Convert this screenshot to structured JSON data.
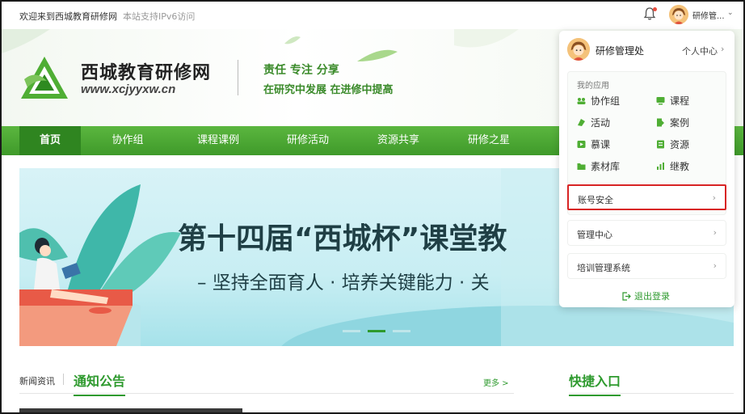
{
  "topbar": {
    "welcome": "欢迎来到西城教育研修网",
    "ipv6": "本站支持IPv6访问",
    "user_short": "研修管..."
  },
  "header": {
    "site_name": "西城教育研修网",
    "site_url": "www.xcjyyxw.cn",
    "slogan_line1": "责任  专注  分享",
    "slogan_line2": "在研究中发展 在进修中提高"
  },
  "nav": {
    "items": [
      {
        "label": "首页"
      },
      {
        "label": "协作组"
      },
      {
        "label": "课程课例"
      },
      {
        "label": "研修活动"
      },
      {
        "label": "资源共享"
      },
      {
        "label": "研修之星"
      }
    ],
    "active_index": 0
  },
  "banner": {
    "title": "第十四届“西城杯”课堂教",
    "subtitle": "– 坚持全面育人 · 培养关键能力 · 关",
    "slide_count": 3,
    "active_slide": 1
  },
  "news": {
    "label": "新闻资讯",
    "tab": "通知公告",
    "more": "更多 >"
  },
  "quick": {
    "title": "快捷入口"
  },
  "dropdown": {
    "user_name": "研修管理处",
    "personal_center": "个人中心",
    "apps_label": "我的应用",
    "apps": [
      {
        "label": "协作组",
        "icon": "group-icon"
      },
      {
        "label": "课程",
        "icon": "course-icon"
      },
      {
        "label": "活动",
        "icon": "activity-icon"
      },
      {
        "label": "案例",
        "icon": "case-icon"
      },
      {
        "label": "慕课",
        "icon": "mooc-icon"
      },
      {
        "label": "资源",
        "icon": "resource-icon"
      },
      {
        "label": "素材库",
        "icon": "folder-icon"
      },
      {
        "label": "继教",
        "icon": "stats-icon"
      }
    ],
    "rows": [
      {
        "label": "账号安全"
      },
      {
        "label": "管理中心"
      },
      {
        "label": "培训管理系统"
      }
    ],
    "logout": "退出登录"
  },
  "colors": {
    "brand_green": "#3f9a2a",
    "accent_green": "#2e9a2e",
    "highlight_red": "#d82424"
  }
}
